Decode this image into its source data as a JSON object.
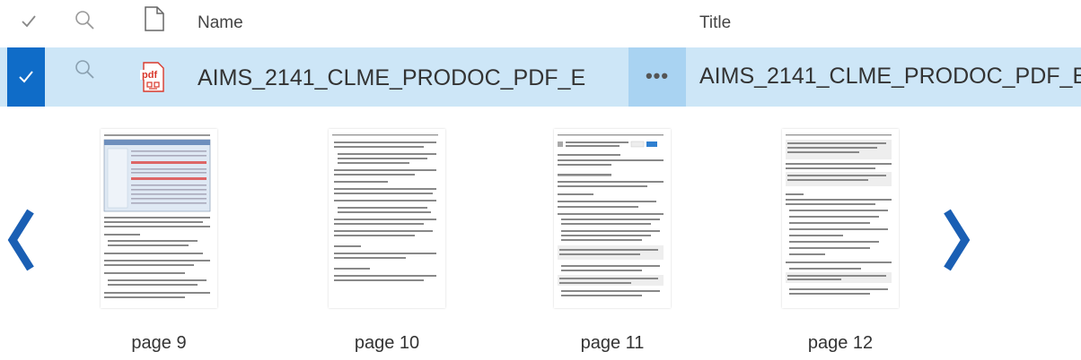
{
  "header": {
    "check_icon": "checkmark-icon",
    "search_icon": "search-icon",
    "file_icon": "document-icon",
    "name_label": "Name",
    "title_label": "Title"
  },
  "row": {
    "selected": true,
    "file_type_icon": "pdf-icon",
    "name": "AIMS_2141_CLME_PRODOC_PDF_E",
    "more_icon": "more-icon",
    "more_label": "•••",
    "title": "AIMS_2141_CLME_PRODOC_PDF_E",
    "pdf_badge": "pdf"
  },
  "preview": {
    "prev_icon": "chevron-left-icon",
    "next_icon": "chevron-right-icon",
    "pages": [
      {
        "label": "page 9"
      },
      {
        "label": "page 10"
      },
      {
        "label": "page 11"
      },
      {
        "label": "page 12"
      }
    ]
  },
  "colors": {
    "selected_row_bg": "#cde6f7",
    "check_bg": "#0f6cc8",
    "more_bg": "#a9d3f2",
    "nav_arrow": "#1a5fb4",
    "pdf_red": "#d9382c"
  }
}
